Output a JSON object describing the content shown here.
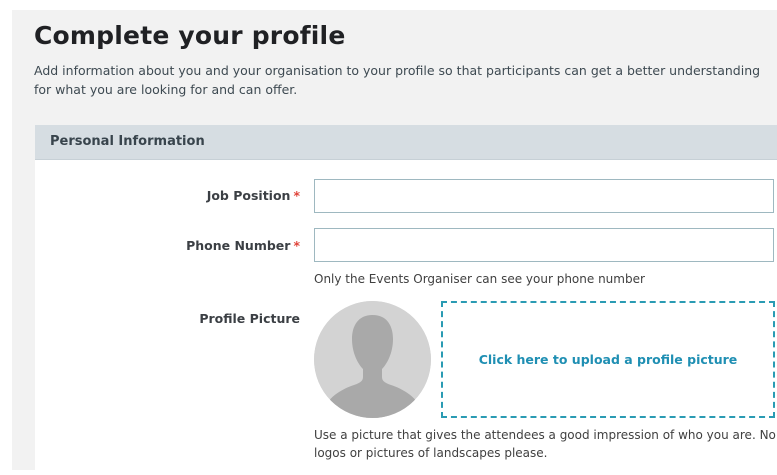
{
  "page": {
    "title": "Complete your profile",
    "intro": "Add information about you and your organisation to your profile so that participants can get a better understanding for what you are looking for and can offer."
  },
  "section": {
    "title": "Personal Information"
  },
  "fields": {
    "job_position": {
      "label": "Job Position",
      "required_mark": "*",
      "value": "",
      "placeholder": ""
    },
    "phone_number": {
      "label": "Phone Number",
      "required_mark": "*",
      "value": "",
      "placeholder": "",
      "hint": "Only the Events Organiser can see your phone number"
    },
    "profile_picture": {
      "label": "Profile Picture",
      "upload_text": "Click here to upload a profile picture",
      "hint": "Use a picture that gives the attendees a good impression of who you are. No logos or pictures of landscapes please."
    }
  },
  "icons": {
    "avatar": "person-silhouette-icon"
  },
  "colors": {
    "accent": "#1f8fb3",
    "required": "#e0443a",
    "section_header": "#d6dde2",
    "page_background": "#f2f2f2",
    "upload_border": "#2a9bb3"
  }
}
